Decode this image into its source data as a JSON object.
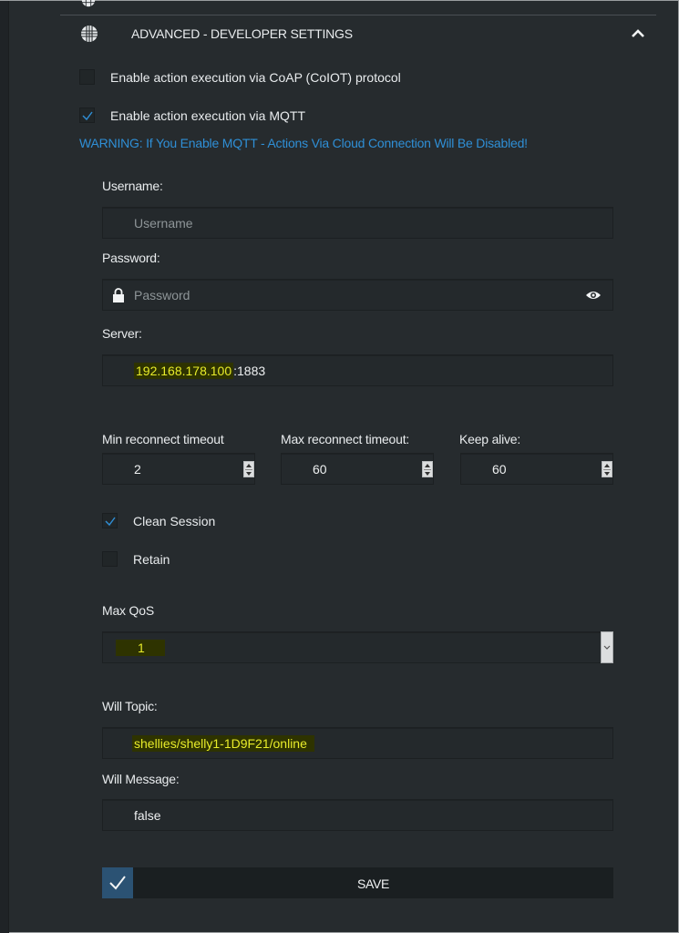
{
  "section": {
    "title": "ADVANCED - DEVELOPER SETTINGS",
    "icon": "globe-icon",
    "expanded": true,
    "collapse_icon": "chevron-up-icon"
  },
  "options": {
    "coap": {
      "label": "Enable action execution via CoAP (CoIOT) protocol",
      "checked": false
    },
    "mqtt": {
      "label": "Enable action execution via MQTT",
      "checked": true
    }
  },
  "warning": "WARNING: If You Enable MQTT - Actions Via Cloud Connection Will Be Disabled!",
  "username": {
    "label": "Username:",
    "placeholder": "Username",
    "value": ""
  },
  "password": {
    "label": "Password:",
    "placeholder": "Password",
    "value": "",
    "lock_icon": "lock-icon",
    "reveal_icon": "eye-icon"
  },
  "server": {
    "label": "Server:",
    "host": "192.168.178.100",
    "port_suffix": ":1883"
  },
  "timeouts": {
    "min_reconnect": {
      "label": "Min reconnect timeout",
      "value": "2"
    },
    "max_reconnect": {
      "label": "Max reconnect timeout:",
      "value": "60"
    },
    "keep_alive": {
      "label": "Keep alive:",
      "value": "60"
    }
  },
  "clean_session": {
    "label": "Clean Session",
    "checked": true
  },
  "retain": {
    "label": "Retain",
    "checked": false
  },
  "max_qos": {
    "label": "Max QoS",
    "selected": "1"
  },
  "will_topic": {
    "label": "Will Topic:",
    "value": "shellies/shelly1-1D9F21/online"
  },
  "will_message": {
    "label": "Will Message:",
    "value": "false"
  },
  "save": {
    "label": "SAVE",
    "icon": "checkmark-icon"
  },
  "colors": {
    "background": "#262b2e",
    "warning": "#2f8fd6",
    "highlight_text": "#e8ec2a",
    "save_accent": "#2b5273"
  }
}
